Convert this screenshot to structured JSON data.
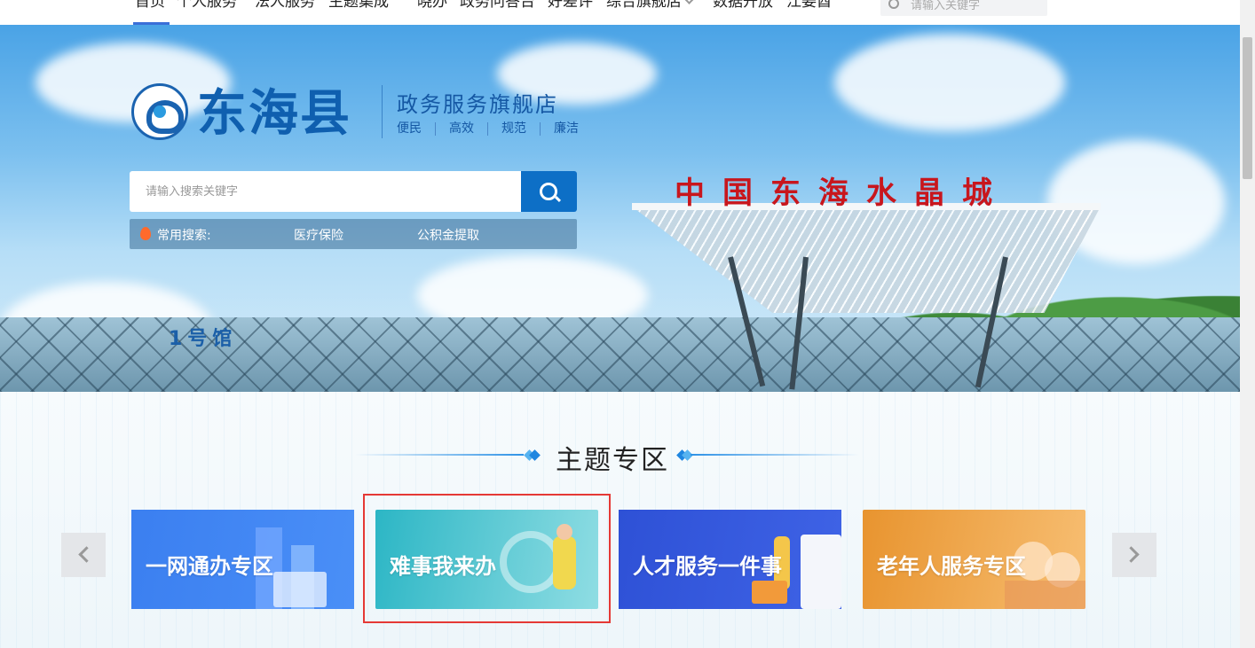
{
  "nav": {
    "items": [
      "首页",
      "个人服务",
      "法人服务",
      "主题集成",
      "晓办",
      "政务问答台",
      "好差评",
      "综合旗舰店",
      "数据开放",
      "江姜酋"
    ],
    "search_placeholder": "请输入关键字"
  },
  "hero": {
    "brand_name": "东海县",
    "brand_subtitle": "政务服务旗舰店",
    "brand_tags": [
      "便民",
      "高效",
      "规范",
      "廉洁"
    ],
    "sign_text": "中国东海水晶城",
    "hall_label": "1号馆",
    "search_placeholder": "请输入搜索关键字",
    "hot_label": "常用搜索:",
    "hot_terms": [
      "医疗保险",
      "公积金提取"
    ]
  },
  "theme": {
    "title": "主题专区",
    "cards": [
      {
        "title": "一网通办专区",
        "color": "#3b7ff0"
      },
      {
        "title": "难事我来办",
        "color": "#2cb6c5"
      },
      {
        "title": "人才服务一件事",
        "color": "#2e51d6"
      },
      {
        "title": "老年人服务专区",
        "color": "#e8942f"
      }
    ],
    "highlighted_card": 1
  },
  "icons": {
    "nav_search": "search-icon",
    "hero_search": "search-icon",
    "hot": "fire-icon",
    "prev": "chevron-left-icon",
    "next": "chevron-right-icon"
  },
  "colors": {
    "brand_blue": "#0f5faf",
    "search_button": "#0d6fc6",
    "nav_active": "#3b6fd8",
    "highlight": "#e53935"
  }
}
